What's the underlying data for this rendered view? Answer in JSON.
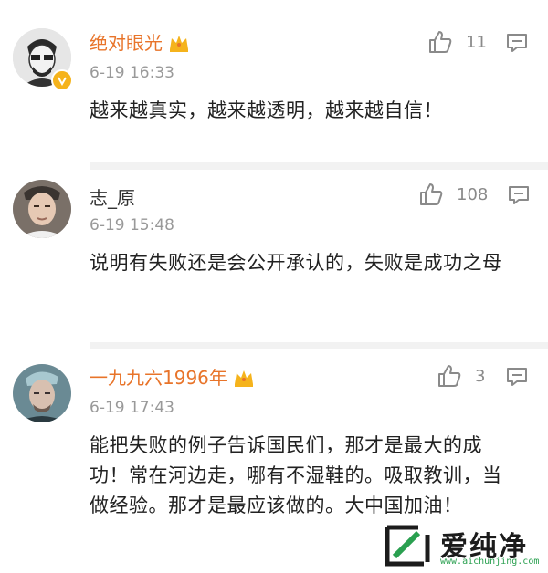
{
  "comments": [
    {
      "username": "绝对眼光",
      "vip": true,
      "verified": true,
      "time": "6-19 16:33",
      "likes": "11",
      "text": "越来越真实，越来越透明，越来越自信！"
    },
    {
      "username": "志_原",
      "vip": false,
      "verified": false,
      "time": "6-19 15:48",
      "likes": "108",
      "text": "说明有失败还是会公开承认的，失败是成功之母"
    },
    {
      "username": "一九九六1996年",
      "vip": true,
      "verified": false,
      "time": "6-19 17:43",
      "likes": "3",
      "text": "能把失败的例子告诉国民们，那才是最大的成功！常在河边走，哪有不湿鞋的。吸取教训，当做经验。那才是最应该做的。大中国加油！"
    }
  ],
  "watermark": {
    "brand": "爱纯净",
    "url": "www.aichunjing.com"
  },
  "colors": {
    "vip_name": "#e8742a",
    "crown": "#f5b31c",
    "verified_badge": "#f5b31c",
    "icon_gray": "#8a8a8a",
    "watermark_green": "#2aa050"
  }
}
